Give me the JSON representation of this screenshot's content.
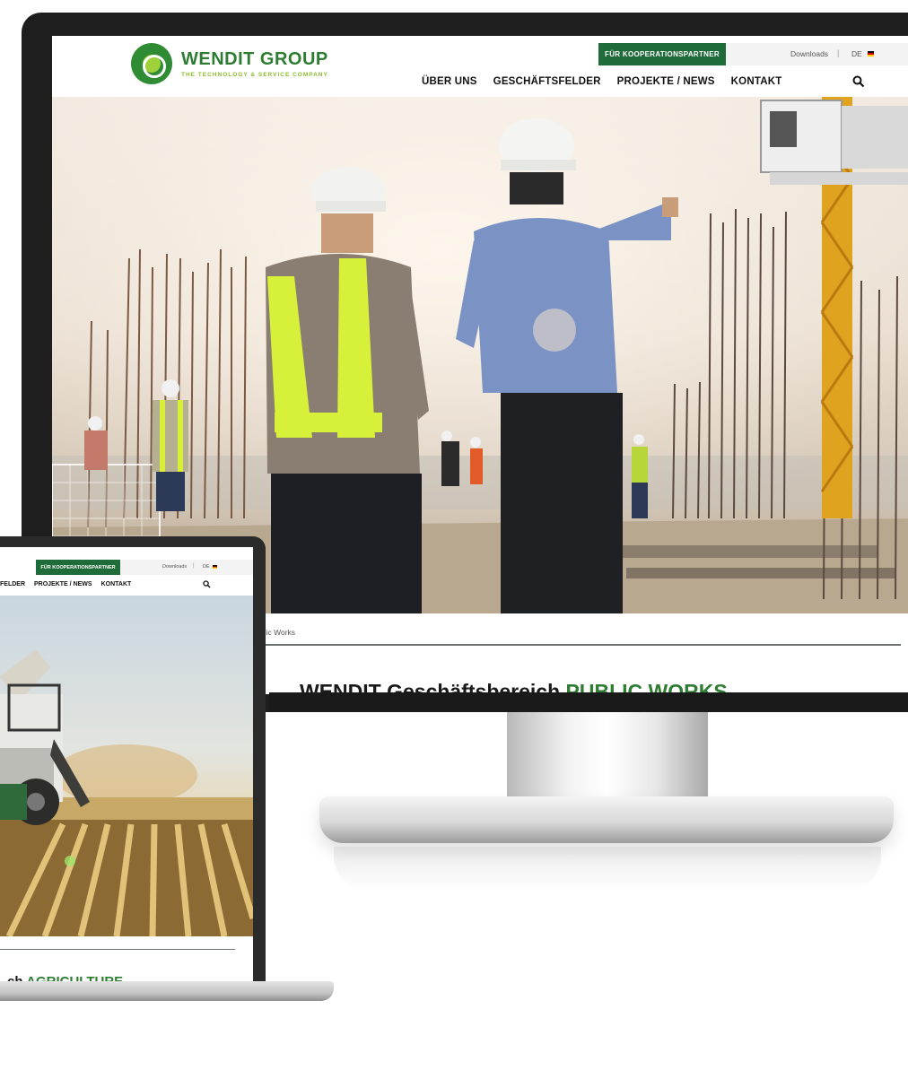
{
  "desktop": {
    "logo": {
      "name": "WENDIT GROUP",
      "tagline": "THE TECHNOLOGY & SERVICE COMPANY"
    },
    "partner_button": "FÜR KOOPERATIONSPARTNER",
    "utility": {
      "downloads": "Downloads",
      "separator": "|",
      "language": "DE"
    },
    "nav": [
      "ÜBER UNS",
      "GESCHÄFTSFELDER",
      "PROJEKTE / NEWS",
      "KONTAKT"
    ],
    "breadcrumb_fragment": "blic Works",
    "headline": {
      "prefix": "WENDIT Geschäftsbereich",
      "accent": "PUBLIC WORKS"
    }
  },
  "laptop": {
    "partner_button": "FÜR KOOPERATIONSPARTNER",
    "utility": {
      "downloads": "Downloads",
      "separator": "|",
      "language": "DE"
    },
    "nav": [
      "FELDER",
      "PROJEKTE / NEWS",
      "KONTAKT"
    ],
    "headline": {
      "prefix": "ch",
      "accent": "AGRICULTURE"
    }
  },
  "colors": {
    "brand_green": "#2e7d32",
    "button_green": "#1f6b3a",
    "logo_lime": "#8bbd2d"
  }
}
